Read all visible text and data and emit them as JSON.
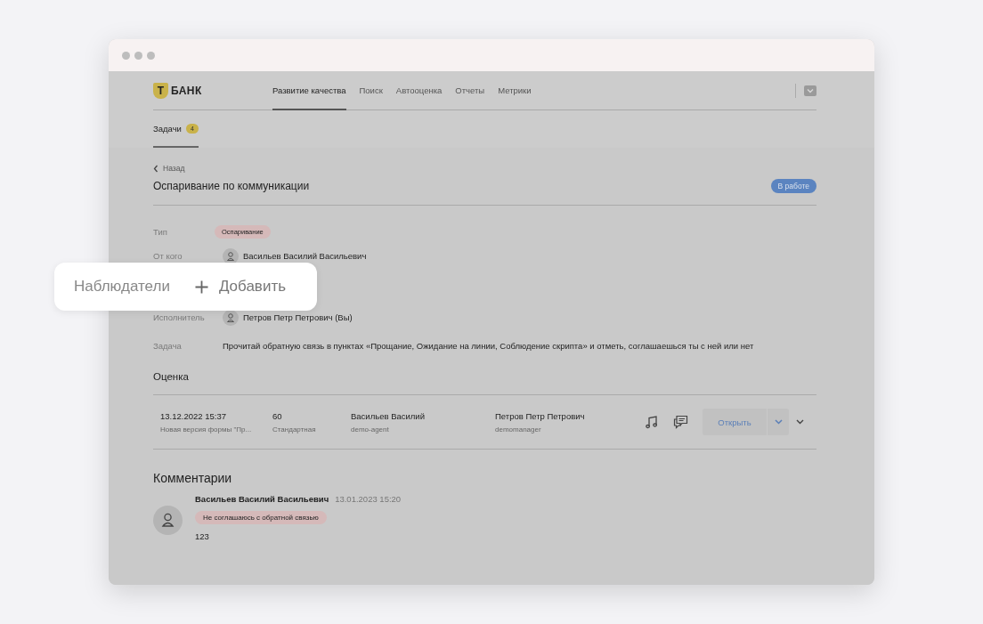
{
  "logo": {
    "mark": "Т",
    "text": "БАНК"
  },
  "nav": [
    {
      "label": "Развитие качества",
      "selected": true
    },
    {
      "label": "Поиск",
      "selected": false
    },
    {
      "label": "Автооценка",
      "selected": false
    },
    {
      "label": "Отчеты",
      "selected": false
    },
    {
      "label": "Метрики",
      "selected": false
    }
  ],
  "subtabs": [
    {
      "label": "Задачи",
      "badge": "4",
      "selected": true
    }
  ],
  "back": "Назад",
  "title": "Оспаривание по коммуникации",
  "status": "В работе",
  "fields": [
    {
      "label": "Тип",
      "kind": "tag",
      "value": "Оспаривание"
    },
    {
      "label": "От кого",
      "kind": "person",
      "value": "Васильев Василий Васильевич"
    },
    {
      "label": "Исполнитель",
      "kind": "person",
      "value": "Петров Петр Петрович (Вы)"
    },
    {
      "label": "Задача",
      "kind": "text",
      "value": "Прочитай обратную связь в пунктах «Прощание, Ожидание на линии, Соблюдение скрипта» и отметь, соглашаешься ты с ней или нет"
    }
  ],
  "callout": {
    "label": "Наблюдатели",
    "action": "Добавить"
  },
  "evaluation": {
    "title": "Оценка",
    "rows": [
      {
        "date": "13.12.2022 15:37",
        "form": "Новая версия формы \"Пр...",
        "score": "60",
        "type": "Стандартная",
        "agent": "Васильев Василий",
        "agent_login": "demo-agent",
        "manager": "Петров Петр Петрович",
        "manager_login": "demomanager",
        "open": "Открыть"
      }
    ]
  },
  "comments": {
    "title": "Комментарии",
    "items": [
      {
        "author": "Васильев Василий Васильевич",
        "time": "13.01.2023 15:20",
        "tag": "Не соглашаюсь с обратной связью",
        "text": "123"
      }
    ]
  }
}
